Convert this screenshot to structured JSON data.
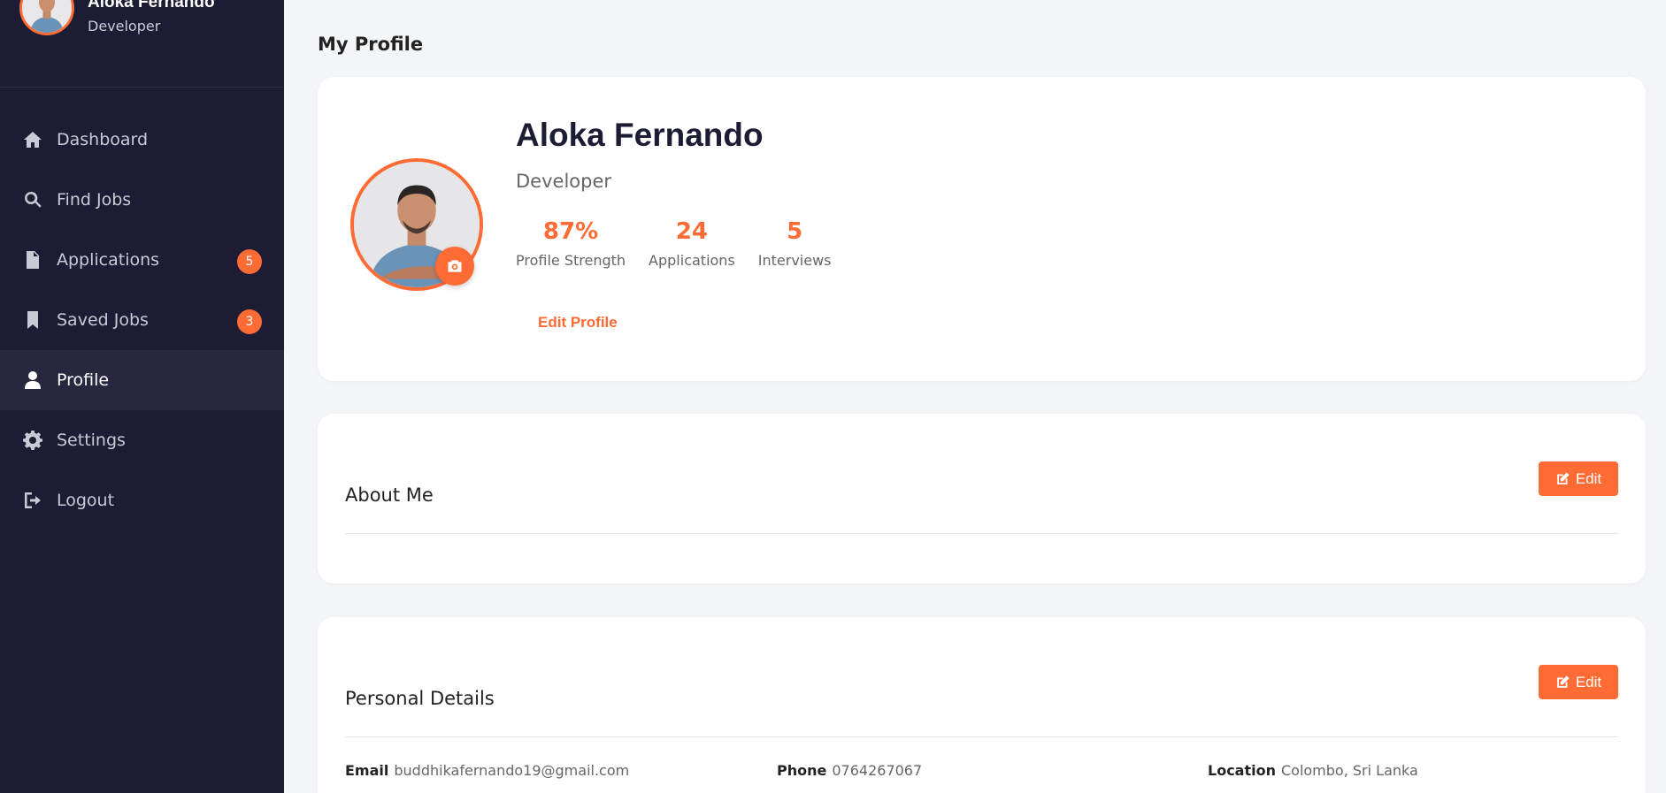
{
  "user": {
    "name": "Aloka Fernando",
    "role": "Developer"
  },
  "sidebar": {
    "items": [
      {
        "label": "Dashboard",
        "icon": "home-icon"
      },
      {
        "label": "Find Jobs",
        "icon": "search-icon"
      },
      {
        "label": "Applications",
        "icon": "document-icon",
        "badge": "5"
      },
      {
        "label": "Saved Jobs",
        "icon": "bookmark-icon",
        "badge": "3"
      },
      {
        "label": "Profile",
        "icon": "user-icon",
        "active": true
      },
      {
        "label": "Settings",
        "icon": "gear-icon"
      },
      {
        "label": "Logout",
        "icon": "logout-icon"
      }
    ]
  },
  "page": {
    "title": "My Profile"
  },
  "profile": {
    "name": "Aloka Fernando",
    "role": "Developer",
    "stats": [
      {
        "value": "87%",
        "label": "Profile Strength"
      },
      {
        "value": "24",
        "label": "Applications"
      },
      {
        "value": "5",
        "label": "Interviews"
      }
    ],
    "edit_label": "Edit Profile"
  },
  "about": {
    "title": "About Me",
    "edit_label": "Edit"
  },
  "personal": {
    "title": "Personal Details",
    "edit_label": "Edit",
    "fields": [
      {
        "label": "Email",
        "value": "buddhikafernando19@gmail.com"
      },
      {
        "label": "Phone",
        "value": "0764267067"
      },
      {
        "label": "Location",
        "value": "Colombo, Sri Lanka"
      }
    ]
  },
  "colors": {
    "accent": "#ff6b35",
    "sidebar_bg": "#1c1c34",
    "page_bg": "#f4f5f7"
  }
}
